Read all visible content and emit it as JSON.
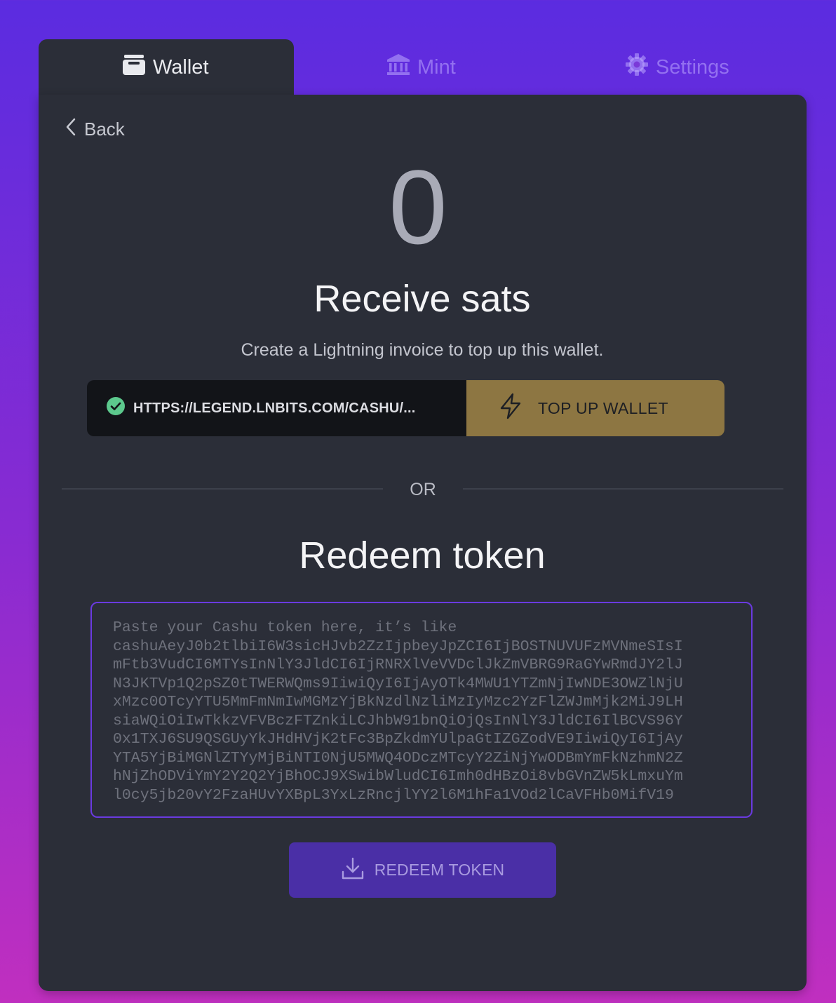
{
  "tabs": [
    {
      "label": "Wallet",
      "icon": "wallet-icon",
      "active": true
    },
    {
      "label": "Mint",
      "icon": "bank-icon",
      "active": false
    },
    {
      "label": "Settings",
      "icon": "gear-icon",
      "active": false
    }
  ],
  "back_label": "Back",
  "balance": "0",
  "receive": {
    "title": "Receive sats",
    "subtitle": "Create a Lightning invoice to top up this wallet.",
    "mint_url": "HTTPS://LEGEND.LNBITS.COM/CASHU/...",
    "topup_label": "TOP UP WALLET"
  },
  "divider_label": "OR",
  "redeem": {
    "title": "Redeem token",
    "placeholder_lines": [
      "Paste your Cashu token here, it’s like",
      "cashuAeyJ0b2tlbiI6W3sicHJvb2ZzIjpbeyJpZCI6IjBOSTNUVUFzMVNmeSIsI",
      "mFtb3VudCI6MTYsInNlY3JldCI6IjRNRXlVeVVDclJkZmVBRG9RaGYwRmdJY2lJ",
      "N3JKTVp1Q2pSZ0tTWERWQms9IiwiQyI6IjAyOTk4MWU1YTZmNjIwNDE3OWZlNjU",
      "xMzc0OTcyYTU5MmFmNmIwMGMzYjBkNzdlNzliMzIyMzc2YzFlZWJmMjk2MiJ9LH",
      "siaWQiOiIwTkkzVFVBczFTZnkiLCJhbW91bnQiOjQsInNlY3JldCI6IlBCVS96Y",
      "0x1TXJ6SU9QSGUyYkJHdHVjK2tFc3BpZkdmYUlpaGtIZGZodVE9IiwiQyI6IjAy",
      "YTA5YjBiMGNlZTYyMjBiNTI0NjU5MWQ4ODczMTcyY2ZiNjYwODBmYmFkNzhmN2Z",
      "hNjZhODViYmY2Y2Q2YjBhOCJ9XSwibWludCI6Imh0dHBzOi8vbGVnZW5kLmxuYm",
      "l0cy5jb20vY2FzaHUvYXBpL3YxLzRncjlYY2l6M1hFa1VOd2lCaVFHb0MifV19"
    ],
    "button_label": "REDEEM TOKEN"
  },
  "colors": {
    "accent": "#5b2ce0",
    "card": "#2b2e38",
    "topup": "#8d7642",
    "redeem": "#4a2fa6",
    "status_ok": "#5cc98d"
  }
}
